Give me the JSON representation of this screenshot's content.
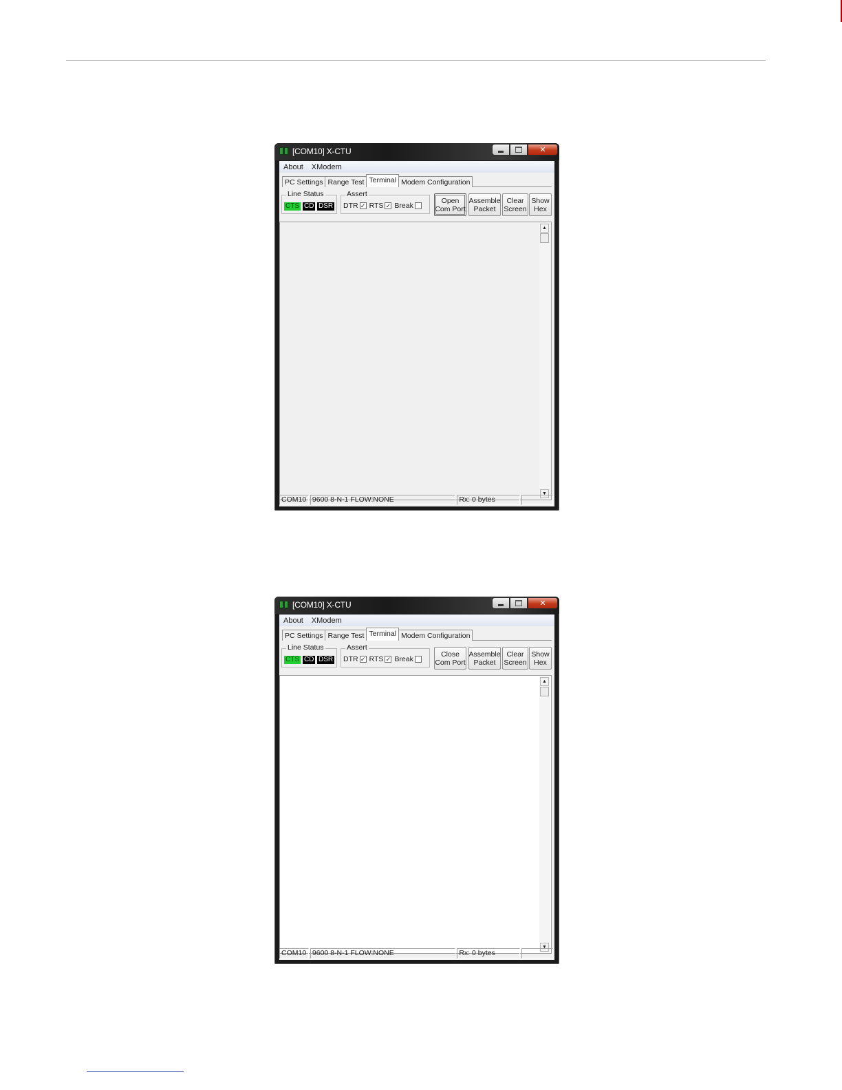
{
  "windows": [
    {
      "title": "[COM10] X-CTU",
      "menu": [
        "About",
        "XModem"
      ],
      "tabs": [
        "PC Settings",
        "Range Test",
        "Terminal",
        "Modem Configuration"
      ],
      "active_tab": "Terminal",
      "line_status": {
        "label": "Line Status",
        "indicators": [
          "CTS",
          "CD",
          "DSR"
        ]
      },
      "assert": {
        "label": "Assert",
        "dtr": "DTR",
        "rts": "RTS",
        "brk": "Break",
        "dtr_checked": true,
        "rts_checked": true,
        "break_checked": false
      },
      "buttons": {
        "port_line1": "Open",
        "port_line2": "Com Port",
        "assemble_line1": "Assemble",
        "assemble_line2": "Packet",
        "clear_line1": "Clear",
        "clear_line2": "Screen",
        "hex_line1": "Show",
        "hex_line2": "Hex"
      },
      "status": {
        "port": "COM10",
        "settings": "9600 8-N-1  FLOW:NONE",
        "rx": "Rx: 0 bytes",
        "extra": ""
      }
    },
    {
      "title": "[COM10] X-CTU",
      "menu": [
        "About",
        "XModem"
      ],
      "tabs": [
        "PC Settings",
        "Range Test",
        "Terminal",
        "Modem Configuration"
      ],
      "active_tab": "Terminal",
      "line_status": {
        "label": "Line Status",
        "indicators": [
          "CTS",
          "CD",
          "DSR"
        ]
      },
      "assert": {
        "label": "Assert",
        "dtr": "DTR",
        "rts": "RTS",
        "brk": "Break",
        "dtr_checked": true,
        "rts_checked": true,
        "break_checked": false
      },
      "buttons": {
        "port_line1": "Close",
        "port_line2": "Com Port",
        "assemble_line1": "Assemble",
        "assemble_line2": "Packet",
        "clear_line1": "Clear",
        "clear_line2": "Screen",
        "hex_line1": "Show",
        "hex_line2": "Hex"
      },
      "status": {
        "port": "COM10",
        "settings": "9600 8-N-1  FLOW:NONE",
        "rx": "Rx: 0 bytes",
        "extra": ""
      }
    }
  ],
  "icons": {
    "check": "✓",
    "scroll_up": "▲",
    "scroll_down": "▼",
    "close": "✕"
  },
  "colors": {
    "cts_on": "#22cc33",
    "indicator_off": "#000000",
    "close_button": "#c23a1b"
  }
}
